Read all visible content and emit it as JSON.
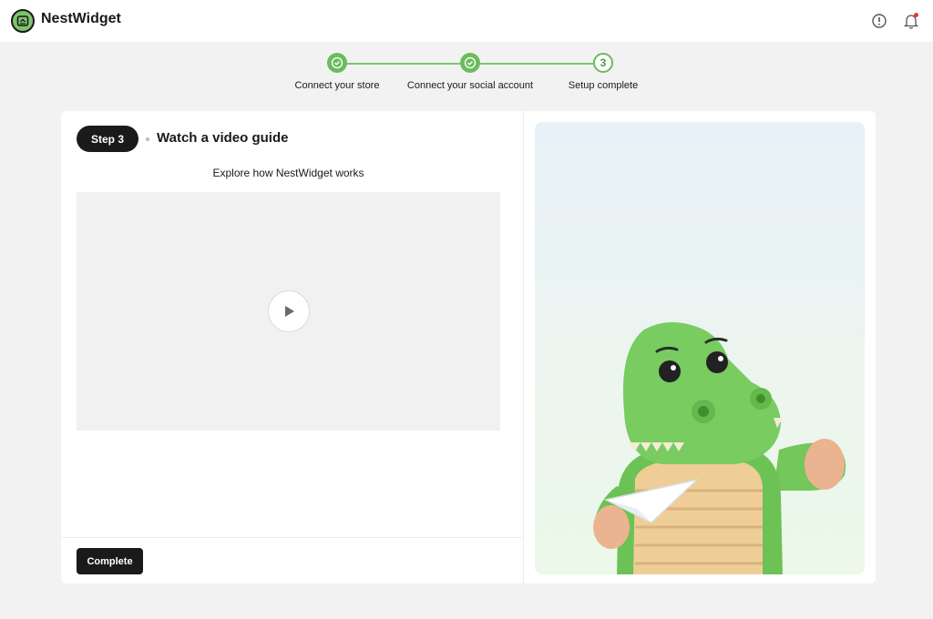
{
  "app": {
    "brand": "NestWidget",
    "accent": "#6cbb5c",
    "dark": "#1a1a1a"
  },
  "header": {
    "icons": [
      "info-icon",
      "bell-icon"
    ]
  },
  "stepper": {
    "steps": [
      {
        "label": "Connect your store",
        "state": "done"
      },
      {
        "label": "Connect your social account",
        "state": "done"
      },
      {
        "label": "Setup complete",
        "state": "current",
        "number": "3"
      }
    ]
  },
  "card": {
    "step_pill": "Step 3",
    "title": "Watch a video guide",
    "subtitle": "Explore how NestWidget works",
    "complete_label": "Complete"
  },
  "illustration": {
    "subject": "green crocodile mascot holding a paper airplane"
  }
}
